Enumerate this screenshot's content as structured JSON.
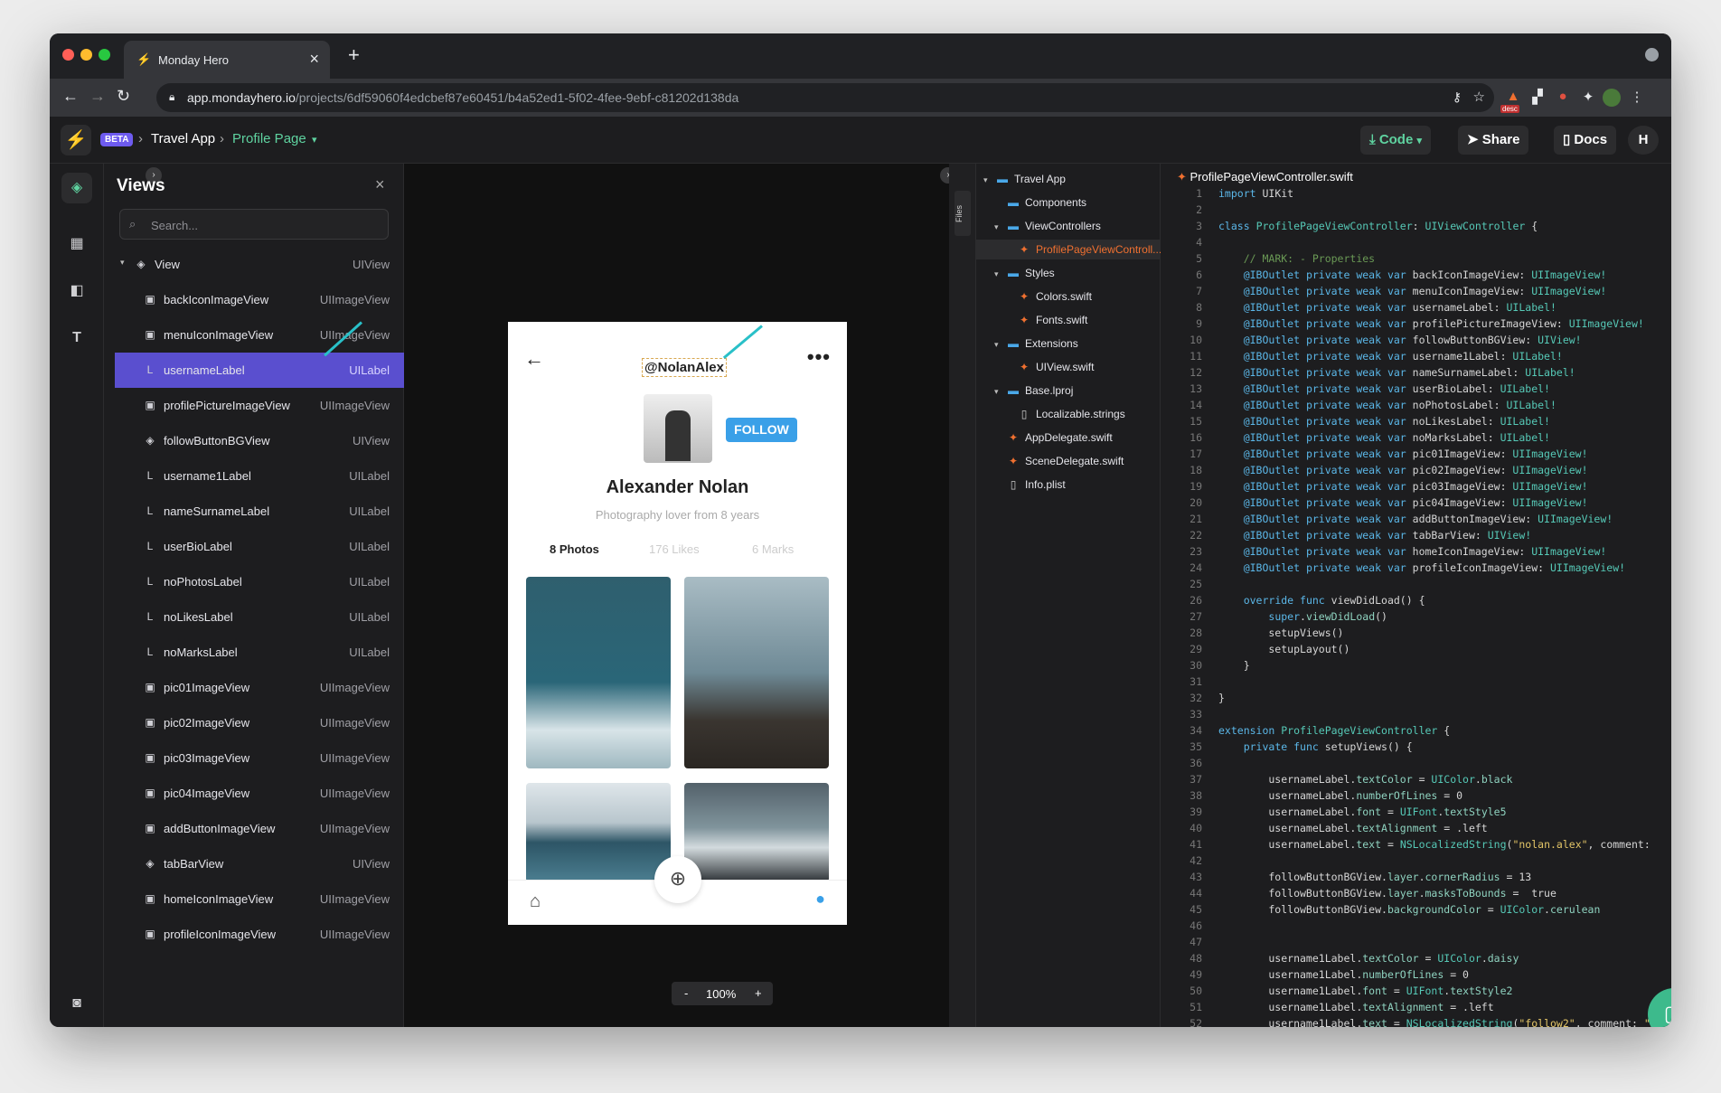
{
  "browser": {
    "tab_title": "Monday Hero",
    "url_host": "app.mondayhero.io",
    "url_path": "/projects/6df59060f4edcbef87e60451/b4a52ed1-5f02-4fee-9ebf-c81202d138da",
    "ext_badge": "desc"
  },
  "header": {
    "beta": "BETA",
    "project": "Travel App",
    "page": "Profile Page",
    "code_btn": "Code",
    "share_btn": "Share",
    "docs_btn": "Docs",
    "user_initial": "H"
  },
  "views": {
    "title": "Views",
    "search_placeholder": "Search...",
    "items": [
      {
        "name": "View",
        "type": "UIView",
        "icon": "layers-icon"
      },
      {
        "name": "backIconImageView",
        "type": "UIImageView",
        "icon": "image-icon"
      },
      {
        "name": "menuIconImageView",
        "type": "UIImageView",
        "icon": "image-icon"
      },
      {
        "name": "usernameLabel",
        "type": "UILabel",
        "icon": "label-icon",
        "selected": true
      },
      {
        "name": "profilePictureImageView",
        "type": "UIImageView",
        "icon": "image-icon"
      },
      {
        "name": "followButtonBGView",
        "type": "UIView",
        "icon": "layers-icon"
      },
      {
        "name": "username1Label",
        "type": "UILabel",
        "icon": "label-icon"
      },
      {
        "name": "nameSurnameLabel",
        "type": "UILabel",
        "icon": "label-icon"
      },
      {
        "name": "userBioLabel",
        "type": "UILabel",
        "icon": "label-icon"
      },
      {
        "name": "noPhotosLabel",
        "type": "UILabel",
        "icon": "label-icon"
      },
      {
        "name": "noLikesLabel",
        "type": "UILabel",
        "icon": "label-icon"
      },
      {
        "name": "noMarksLabel",
        "type": "UILabel",
        "icon": "label-icon"
      },
      {
        "name": "pic01ImageView",
        "type": "UIImageView",
        "icon": "image-icon"
      },
      {
        "name": "pic02ImageView",
        "type": "UIImageView",
        "icon": "image-icon"
      },
      {
        "name": "pic03ImageView",
        "type": "UIImageView",
        "icon": "image-icon"
      },
      {
        "name": "pic04ImageView",
        "type": "UIImageView",
        "icon": "image-icon"
      },
      {
        "name": "addButtonImageView",
        "type": "UIImageView",
        "icon": "image-icon"
      },
      {
        "name": "tabBarView",
        "type": "UIView",
        "icon": "layers-icon"
      },
      {
        "name": "homeIconImageView",
        "type": "UIImageView",
        "icon": "image-icon"
      },
      {
        "name": "profileIconImageView",
        "type": "UIImageView",
        "icon": "image-icon"
      }
    ]
  },
  "phone": {
    "username": "@NolanAlex",
    "follow": "FOLLOW",
    "name": "Alexander Nolan",
    "bio": "Photography lover from 8 years",
    "photos": "8 Photos",
    "likes": "176 Likes",
    "marks": "6 Marks"
  },
  "zoom": {
    "minus": "-",
    "level": "100%",
    "plus": "+"
  },
  "files": {
    "tab": "Files",
    "items": [
      {
        "name": "Travel App",
        "kind": "folder",
        "arrow": "▾"
      },
      {
        "name": "Components",
        "kind": "folder",
        "arrow": ""
      },
      {
        "name": "ViewControllers",
        "kind": "folder",
        "arrow": "▾"
      },
      {
        "name": "ProfilePageViewControll...",
        "kind": "swift",
        "arrow": "",
        "selected": true
      },
      {
        "name": "Styles",
        "kind": "folder",
        "arrow": "▾"
      },
      {
        "name": "Colors.swift",
        "kind": "swift",
        "arrow": ""
      },
      {
        "name": "Fonts.swift",
        "kind": "swift",
        "arrow": ""
      },
      {
        "name": "Extensions",
        "kind": "folder",
        "arrow": "▾"
      },
      {
        "name": "UIView.swift",
        "kind": "swift",
        "arrow": ""
      },
      {
        "name": "Base.lproj",
        "kind": "folder",
        "arrow": "▾"
      },
      {
        "name": "Localizable.strings",
        "kind": "file",
        "arrow": ""
      },
      {
        "name": "AppDelegate.swift",
        "kind": "swift",
        "arrow": ""
      },
      {
        "name": "SceneDelegate.swift",
        "kind": "swift",
        "arrow": ""
      },
      {
        "name": "Info.plist",
        "kind": "file",
        "arrow": ""
      }
    ]
  },
  "code": {
    "filename": "ProfilePageViewController.swift",
    "lines": [
      "<span class='kw'>import</span> UIKit",
      "",
      "<span class='kw'>class</span> <span class='ty'>ProfilePageViewController</span>: <span class='ty'>UIViewController</span> {",
      "",
      "    <span class='cm'>// MARK: - Properties</span>",
      "    <span class='kw'>@IBOutlet private weak var</span> backIconImageView: <span class='ty'>UIImageView!</span>",
      "    <span class='kw'>@IBOutlet private weak var</span> menuIconImageView: <span class='ty'>UIImageView!</span>",
      "    <span class='kw'>@IBOutlet private weak var</span> usernameLabel: <span class='ty'>UILabel!</span>",
      "    <span class='kw'>@IBOutlet private weak var</span> profilePictureImageView: <span class='ty'>UIImageView!</span>",
      "    <span class='kw'>@IBOutlet private weak var</span> followButtonBGView: <span class='ty'>UIView!</span>",
      "    <span class='kw'>@IBOutlet private weak var</span> username1Label: <span class='ty'>UILabel!</span>",
      "    <span class='kw'>@IBOutlet private weak var</span> nameSurnameLabel: <span class='ty'>UILabel!</span>",
      "    <span class='kw'>@IBOutlet private weak var</span> userBioLabel: <span class='ty'>UILabel!</span>",
      "    <span class='kw'>@IBOutlet private weak var</span> noPhotosLabel: <span class='ty'>UILabel!</span>",
      "    <span class='kw'>@IBOutlet private weak var</span> noLikesLabel: <span class='ty'>UILabel!</span>",
      "    <span class='kw'>@IBOutlet private weak var</span> noMarksLabel: <span class='ty'>UILabel!</span>",
      "    <span class='kw'>@IBOutlet private weak var</span> pic01ImageView: <span class='ty'>UIImageView!</span>",
      "    <span class='kw'>@IBOutlet private weak var</span> pic02ImageView: <span class='ty'>UIImageView!</span>",
      "    <span class='kw'>@IBOutlet private weak var</span> pic03ImageView: <span class='ty'>UIImageView!</span>",
      "    <span class='kw'>@IBOutlet private weak var</span> pic04ImageView: <span class='ty'>UIImageView!</span>",
      "    <span class='kw'>@IBOutlet private weak var</span> addButtonImageView: <span class='ty'>UIImageView!</span>",
      "    <span class='kw'>@IBOutlet private weak var</span> tabBarView: <span class='ty'>UIView!</span>",
      "    <span class='kw'>@IBOutlet private weak var</span> homeIconImageView: <span class='ty'>UIImageView!</span>",
      "    <span class='kw'>@IBOutlet private weak var</span> profileIconImageView: <span class='ty'>UIImageView!</span>",
      "",
      "    <span class='kw'>override func</span> viewDidLoad() {",
      "        <span class='kw'>super</span>.<span class='pp'>viewDidLoad</span>()",
      "        setupViews()",
      "        setupLayout()",
      "    }",
      "",
      "}",
      "",
      "<span class='kw'>extension</span> <span class='ty'>ProfilePageViewController</span> {",
      "    <span class='kw'>private func</span> setupViews() {",
      "",
      "        usernameLabel.<span class='pp'>textColor</span> = <span class='ty'>UIColor</span>.<span class='pp'>black</span>",
      "        usernameLabel.<span class='pp'>numberOfLines</span> = 0",
      "        usernameLabel.<span class='pp'>font</span> = <span class='ty'>UIFont</span>.<span class='pp'>textStyle5</span>",
      "        usernameLabel.<span class='pp'>textAlignment</span> = .left",
      "        usernameLabel.<span class='pp'>text</span> = <span class='ty'>NSLocalizedString</span>(<span class='st'>\"nolan.alex\"</span>, comment:",
      "",
      "        followButtonBGView.<span class='pp'>layer</span>.<span class='pp'>cornerRadius</span> = 13",
      "        followButtonBGView.<span class='pp'>layer</span>.<span class='pp'>masksToBounds</span> =  true",
      "        followButtonBGView.<span class='pp'>backgroundColor</span> = <span class='ty'>UIColor</span>.<span class='pp'>cerulean</span>",
      "",
      "",
      "        username1Label.<span class='pp'>textColor</span> = <span class='ty'>UIColor</span>.<span class='pp'>daisy</span>",
      "        username1Label.<span class='pp'>numberOfLines</span> = 0",
      "        username1Label.<span class='pp'>font</span> = <span class='ty'>UIFont</span>.<span class='pp'>textStyle2</span>",
      "        username1Label.<span class='pp'>textAlignment</span> = .left",
      "        username1Label.<span class='pp'>text</span> = <span class='ty'>NSLocalizedString</span>(<span class='st'>\"follow2\"</span>, comment: <span class='st'>\"</span>"
    ]
  }
}
